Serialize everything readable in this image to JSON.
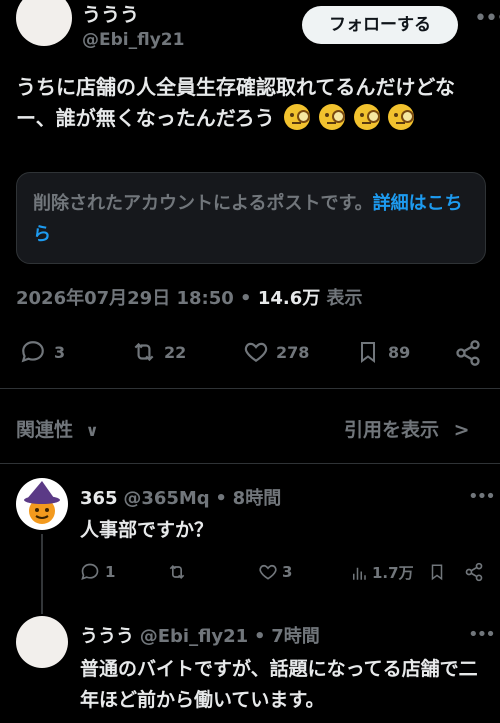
{
  "author": {
    "name": "ううう",
    "handle": "@Ebi_fly21"
  },
  "follow_label": "フォローする",
  "post": {
    "text": "うちに店舗の人全員生存確認取れてるんだけどなー、誰が無くなったんだろう",
    "emoji_names": [
      "face-with-monocle",
      "face-with-monocle",
      "face-with-monocle",
      "face-with-monocle"
    ]
  },
  "deleted_notice": {
    "text": "削除されたアカウントによるポストです。",
    "link": "詳細はこちら"
  },
  "meta": {
    "datetime": "2026年07月29日 18:50",
    "separator": "•",
    "views": "14.6万",
    "views_label": "表示"
  },
  "actions": {
    "replies": "3",
    "reposts": "22",
    "likes": "278",
    "bookmarks": "89"
  },
  "section": {
    "relevance_label": "関連性",
    "quotes_label": "引用を表示"
  },
  "replies": [
    {
      "name": "365",
      "handle": "@365Mq",
      "separator": "•",
      "time": "8時間",
      "text": "人事部ですか？",
      "replies": "1",
      "likes": "3",
      "views": "1.7万"
    },
    {
      "name": "ううう",
      "handle": "@Ebi_fly21",
      "separator": "•",
      "time": "7時間",
      "text": "普通のバイトですが、話題になってる店舗で二年ほど前から働いています。"
    }
  ],
  "colors": {
    "background": "#000000",
    "text_primary": "#e7e9ea",
    "text_secondary": "#71767b",
    "link": "#1d9bf0",
    "border": "#2f3336"
  }
}
